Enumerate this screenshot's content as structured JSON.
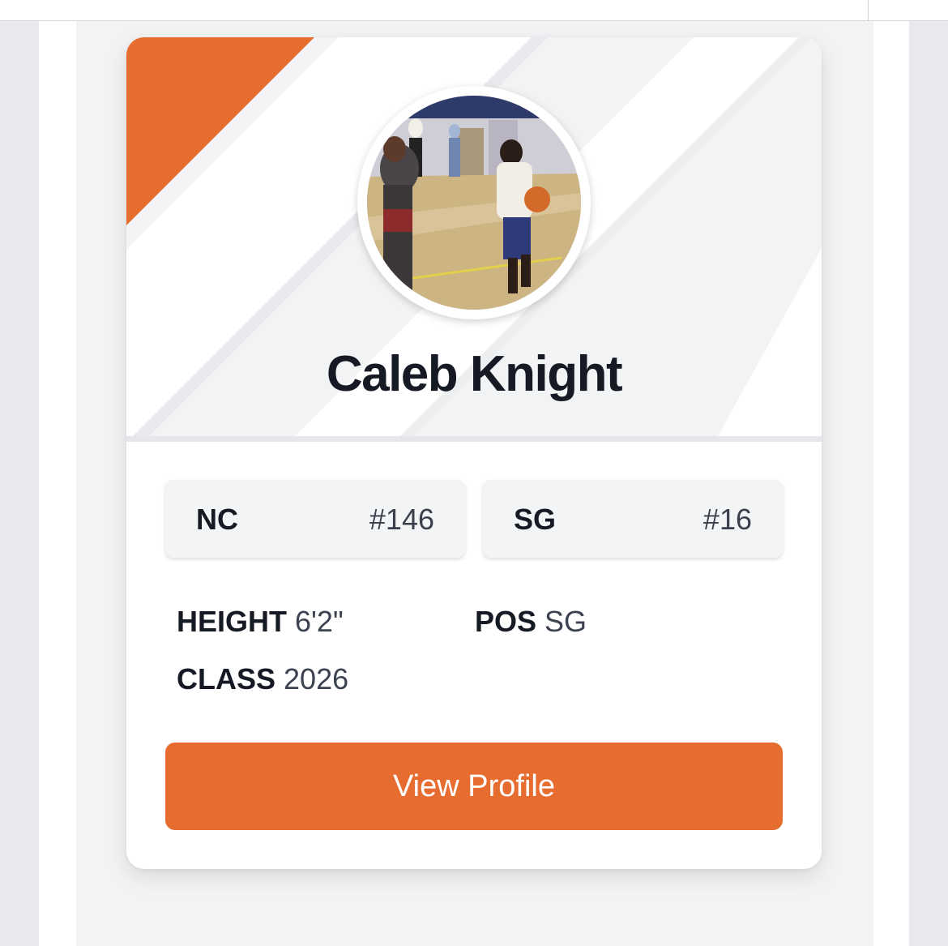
{
  "player": {
    "name": "Caleb Knight",
    "photo_alt": "Player dribbling basketball in gym"
  },
  "rankings": [
    {
      "label": "NC",
      "value": "#146"
    },
    {
      "label": "SG",
      "value": "#16"
    }
  ],
  "attributes": {
    "height": {
      "label": "HEIGHT",
      "value": "6'2\""
    },
    "position": {
      "label": "POS",
      "value": "SG"
    },
    "class": {
      "label": "CLASS",
      "value": "2026"
    }
  },
  "actions": {
    "view_profile": "View Profile"
  },
  "colors": {
    "accent": "#e66c30",
    "text_dark": "#161a24",
    "card_bg": "#ffffff",
    "hero_bg": "#f2f3f5"
  }
}
